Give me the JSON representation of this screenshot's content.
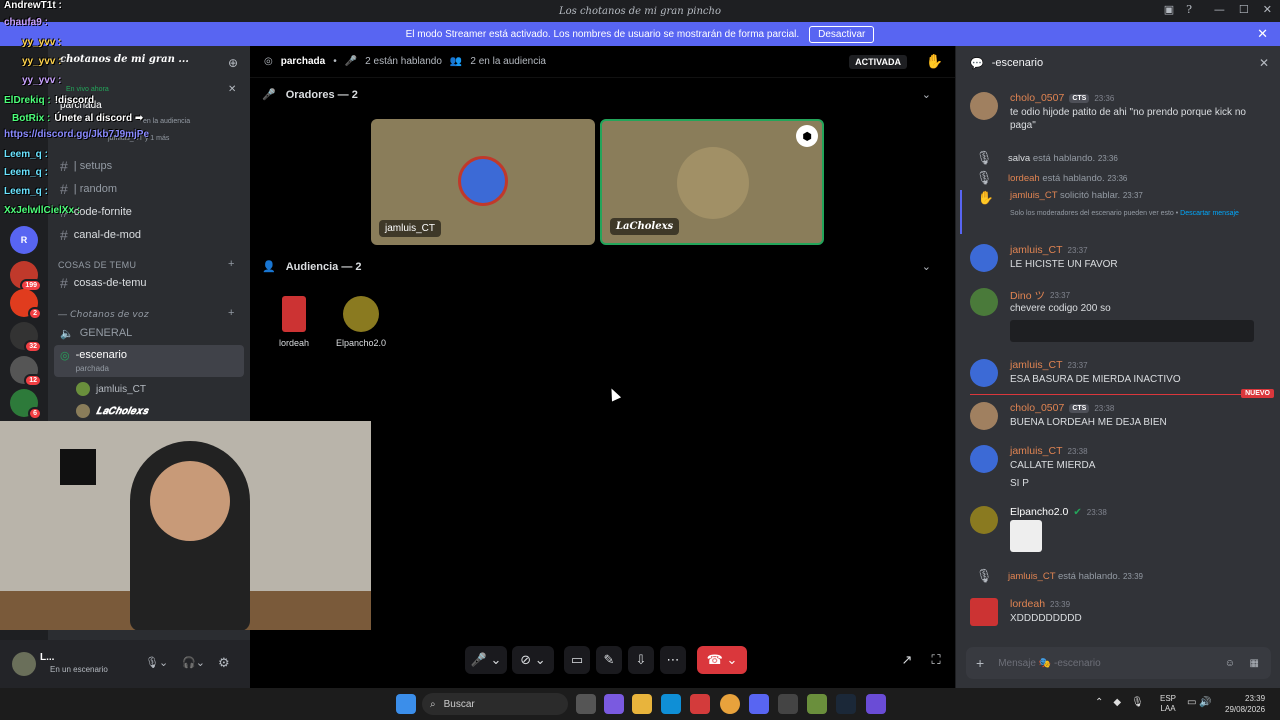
{
  "window": {
    "title": "𝓛𝓸𝓼 𝓬𝓱𝓸𝓽𝓪𝓷𝓸𝓼 𝓭𝓮 𝓶𝓲 𝓰𝓻𝓪𝓷 𝓹𝓲𝓷𝓬𝓱𝓸",
    "title_plain": "Los chotanos de mi gran pincho"
  },
  "streamer_banner": {
    "text": "El modo Streamer está activado. Los nombres de usuario se mostrarán de forma parcial.",
    "button": "Desactivar"
  },
  "server": {
    "name": "chotanos de mi gran ...",
    "voice_status": "En vivo ahora",
    "voice_channel": "parchada",
    "audience_hint": "en la audiencia",
    "members_hint": "jamluis_CT y 1 más"
  },
  "channels": [
    {
      "label": "| setups",
      "emoji": "🎮"
    },
    {
      "label": "| random",
      "emoji": "🐱"
    },
    {
      "label": "code-fornite"
    },
    {
      "label": "canal-de-mod"
    }
  ],
  "categories": {
    "cosas": "COSAS DE TEMU",
    "voz": "— 𝘊𝘩𝘰𝘵𝘢𝘯𝘰𝘴 𝘥𝘦 𝘷𝘰𝘻"
  },
  "cosas_channels": [
    {
      "label": "cosas-de-temu"
    }
  ],
  "voice_channels": [
    {
      "label": "GENERAL"
    },
    {
      "label": "-escenario",
      "sub": "parchada"
    }
  ],
  "stage_users": [
    "jamluis_CT",
    "𝑳𝒂𝑪𝒉𝒐𝒍𝒆𝒙𝒔"
  ],
  "user": {
    "name": "L...",
    "status": "En un escenario"
  },
  "overlay_chat": [
    {
      "name": "AndrewT1t :",
      "color": "#ffffff"
    },
    {
      "name": "chaufa9 :",
      "color": "#c9a2ff"
    },
    {
      "name": "yy_yvv :",
      "color": "#ffd34d"
    },
    {
      "name": "yy_yvv :",
      "color": "#ffd34d"
    },
    {
      "name": "yy_yvv :",
      "color": "#c9a2ff"
    },
    {
      "name": "ElDrekiq :",
      "color": "#4dff7a",
      "text": "!discord"
    },
    {
      "name": "BotRix :",
      "color": "#4dff7a",
      "text": "Únete al discord ➡"
    },
    {
      "name": "https://discord.gg/Jkb7J9mjPe",
      "color": "#8a8aff"
    },
    {
      "name": "Leem_q :",
      "color": "#6ae3ff"
    },
    {
      "name": "Leem_q :",
      "color": "#6ae3ff"
    },
    {
      "name": "Leem_q :",
      "color": "#6ae3ff"
    },
    {
      "name": "XxJelwllCielXx :",
      "color": "#4dff7a"
    }
  ],
  "stage": {
    "channel": "parchada",
    "speaking": "2 están hablando",
    "audience_count": "2 en la audiencia",
    "activated": "ACTIVADA",
    "speakers_header": "Oradores — 2",
    "audience_header": "Audiencia — 2",
    "speakers": [
      "jamluis_CT",
      "𝑳𝒂𝑪𝒉𝒐𝒍𝒆𝒙𝒔"
    ],
    "audience": [
      "lordeah",
      "Elpancho2.0"
    ]
  },
  "chat": {
    "title": "-escenario",
    "placeholder": "Mensaje 🎭 -escenario",
    "messages": [
      {
        "name": "cholo_0507",
        "tag": "CTS",
        "time": "23:36",
        "text": "te odio hijode patito de ahi \"no prendo porque kick no paga\""
      },
      {
        "name": "jamluis_CT",
        "time": "23:37",
        "text": "LE HICISTE UN FAVOR"
      },
      {
        "name": "Dino ツ",
        "time": "23:37",
        "text": "chevere codigo 200 so"
      },
      {
        "name": "jamluis_CT",
        "time": "23:37",
        "text": "ESA BASURA DE MIERDA INACTIVO"
      },
      {
        "name": "cholo_0507",
        "tag": "CTS",
        "time": "23:38",
        "text": "BUENA LORDEAH ME DEJA BIEN"
      },
      {
        "name": "jamluis_CT",
        "time": "23:38",
        "text": "CALLATE MIERDA",
        "text2": "SI P"
      },
      {
        "name": "Elpancho2.0",
        "time": "23:38"
      },
      {
        "name": "lordeah",
        "time": "23:39",
        "text": "XDDDDDDDDD"
      }
    ],
    "system": [
      {
        "name": "salva",
        "text": "está hablando.",
        "time": "23:36"
      },
      {
        "name": "lordeah",
        "text": "está hablando.",
        "time": "23:36"
      },
      {
        "name": "jamluis_CT",
        "text": "solicitó hablar.",
        "time": "23:37",
        "note": "Solo los moderadores del escenario pueden ver esto • ",
        "link": "Descartar mensaje"
      },
      {
        "name": "jamluis_CT",
        "text": "está hablando.",
        "time": "23:39"
      }
    ],
    "new_badge": "NUEVO"
  },
  "taskbar": {
    "search": "Buscar",
    "lang": "ESP",
    "lang2": "LAA",
    "time": "23:39",
    "date": "29/08/2026"
  },
  "colors": {
    "accent": "#5865f2",
    "danger": "#da373c",
    "name": "#e08452",
    "green": "#23a55a"
  }
}
